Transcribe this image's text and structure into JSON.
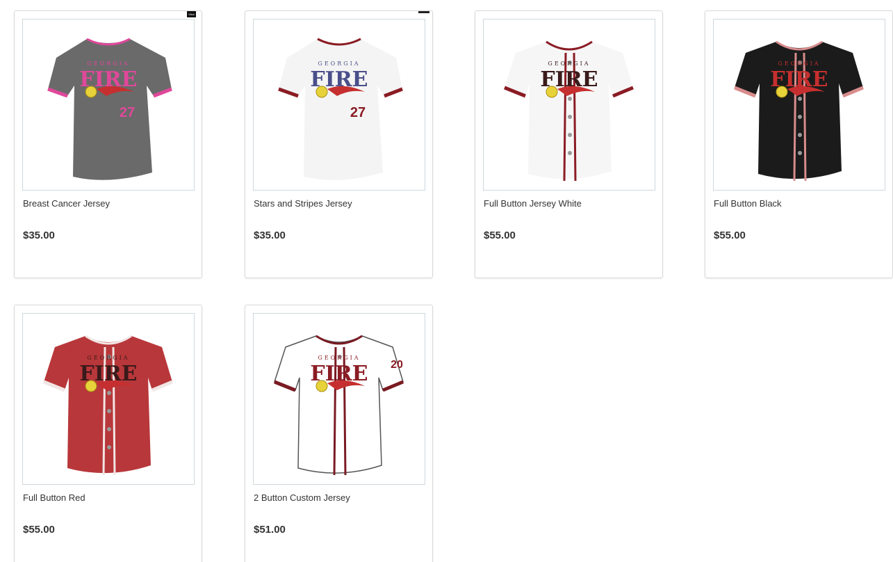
{
  "products": [
    {
      "name": "Breast Cancer Jersey",
      "price": "$35.00",
      "style": "tee",
      "body_color": "#6a6a6a",
      "trim_color": "#e0489a",
      "logo_color": "#e0489a",
      "number": "27",
      "number_color": "#e0489a",
      "overlay_badge": "View"
    },
    {
      "name": "Stars and Stripes Jersey",
      "price": "$35.00",
      "style": "tee",
      "body_color": "#f4f4f4",
      "trim_color": "#8b1c24",
      "logo_color": "#4a4f8a",
      "number": "27",
      "number_color": "#8b1c24",
      "overlay_badge": ""
    },
    {
      "name": "Full Button Jersey White",
      "price": "$55.00",
      "style": "button",
      "body_color": "#f6f6f6",
      "trim_color": "#8b1c24",
      "logo_color": "#3a1a1a",
      "number": "",
      "number_color": "#8b1c24",
      "overlay_badge": ""
    },
    {
      "name": "Full Button Black",
      "price": "$55.00",
      "style": "button",
      "body_color": "#1b1b1b",
      "trim_color": "#d98c8c",
      "logo_color": "#c62f2f",
      "number": "",
      "number_color": "#c62f2f",
      "overlay_badge": ""
    },
    {
      "name": "Full Button Red",
      "price": "$55.00",
      "style": "button",
      "body_color": "#b8373a",
      "trim_color": "#f2e6e6",
      "logo_color": "#3a1a1a",
      "number": "",
      "number_color": "#f2e6e6",
      "overlay_badge": ""
    },
    {
      "name": "2 Button Custom Jersey",
      "price": "$51.00",
      "style": "outline",
      "body_color": "#ffffff",
      "trim_color": "#7a1a22",
      "logo_color": "#8b1c24",
      "number": "20",
      "number_color": "#8b1c24",
      "overlay_badge": ""
    }
  ],
  "logo": {
    "top_text": "GEORGIA",
    "main_text": "FIRE"
  }
}
